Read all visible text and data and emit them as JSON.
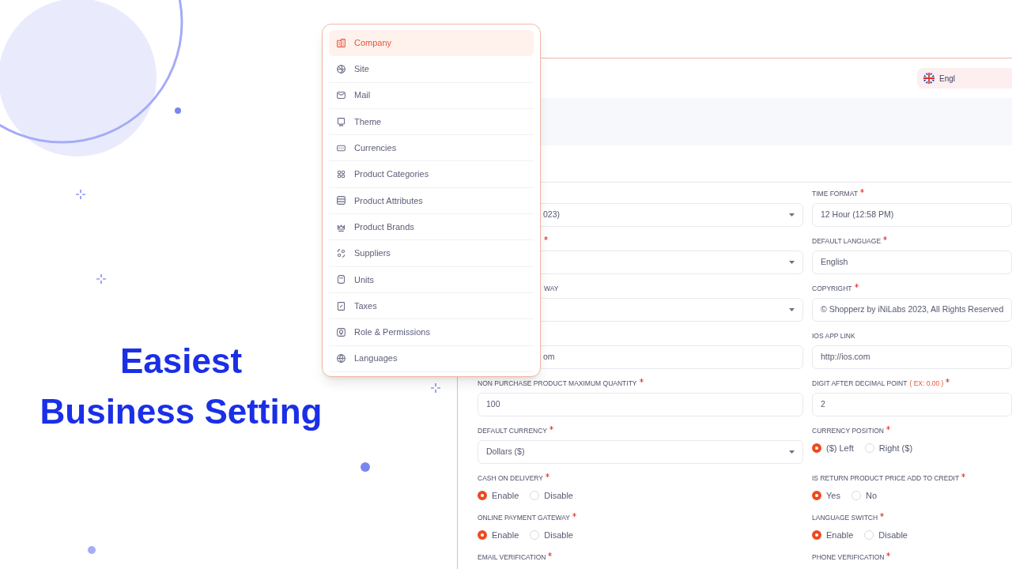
{
  "headline": [
    "Easiest",
    "Business Setting"
  ],
  "settings_menu": [
    {
      "label": "Company",
      "selected": true
    },
    {
      "label": "Site",
      "selected": false
    },
    {
      "label": "Mail",
      "selected": false
    },
    {
      "label": "Theme",
      "selected": false
    },
    {
      "label": "Currencies",
      "selected": false
    },
    {
      "label": "Product Categories",
      "selected": false
    },
    {
      "label": "Product Attributes",
      "selected": false
    },
    {
      "label": "Product Brands",
      "selected": false
    },
    {
      "label": "Suppliers",
      "selected": false
    },
    {
      "label": "Units",
      "selected": false
    },
    {
      "label": "Taxes",
      "selected": false
    },
    {
      "label": "Role & Permissions",
      "selected": false
    },
    {
      "label": "Languages",
      "selected": false
    }
  ],
  "language_button": {
    "label": "Engl"
  },
  "form": {
    "rows": [
      [
        {
          "kind": "select",
          "value": "023)"
        },
        {
          "label": "TIME FORMAT",
          "required": true,
          "kind": "input",
          "value": "12 Hour (12:58 PM)"
        }
      ],
      [
        {
          "required": true,
          "kind": "select"
        },
        {
          "label": "DEFAULT LANGUAGE",
          "required": true,
          "kind": "input",
          "value": "English"
        }
      ],
      [
        {
          "label": "WAY",
          "kind": "select"
        },
        {
          "label": "COPYRIGHT",
          "required": true,
          "kind": "input",
          "value": "© Shopperz by iNiLabs 2023, All Rights Reserved"
        }
      ],
      [
        {
          "kind": "input",
          "value": "om"
        },
        {
          "label": "IOS APP LINK",
          "kind": "input",
          "value": "http://ios.com"
        }
      ],
      [
        {
          "label": "NON PURCHASE PRODUCT MAXIMUM QUANTITY",
          "required": true,
          "kind": "input",
          "value": "100"
        },
        {
          "label": "DIGIT AFTER DECIMAL POINT",
          "hint": "( EX: 0.00 )",
          "required": true,
          "kind": "input",
          "value": "2"
        }
      ],
      [
        {
          "label": "DEFAULT CURRENCY",
          "required": true,
          "kind": "select",
          "value": "Dollars ($)"
        },
        {
          "label": "CURRENCY POSITION",
          "required": true,
          "kind": "radio",
          "options": [
            {
              "label": "($) Left",
              "selected": true
            },
            {
              "label": "Right ($)",
              "selected": false
            }
          ]
        }
      ],
      [
        {
          "label": "CASH ON DELIVERY",
          "required": true,
          "kind": "radio",
          "options": [
            {
              "label": "Enable",
              "selected": true
            },
            {
              "label": "Disable",
              "selected": false
            }
          ]
        },
        {
          "label": "IS RETURN PRODUCT PRICE ADD TO CREDIT",
          "required": true,
          "kind": "radio",
          "options": [
            {
              "label": "Yes",
              "selected": true
            },
            {
              "label": "No",
              "selected": false
            }
          ]
        }
      ],
      [
        {
          "label": "ONLINE PAYMENT GATEWAY",
          "required": true,
          "kind": "radio",
          "options": [
            {
              "label": "Enable",
              "selected": true
            },
            {
              "label": "Disable",
              "selected": false
            }
          ]
        },
        {
          "label": "LANGUAGE SWITCH",
          "required": true,
          "kind": "radio",
          "options": [
            {
              "label": "Enable",
              "selected": true
            },
            {
              "label": "Disable",
              "selected": false
            }
          ]
        }
      ],
      [
        {
          "label": "EMAIL VERIFICATION",
          "required": true
        },
        {
          "label": "PHONE VERIFICATION",
          "required": true
        }
      ]
    ]
  }
}
